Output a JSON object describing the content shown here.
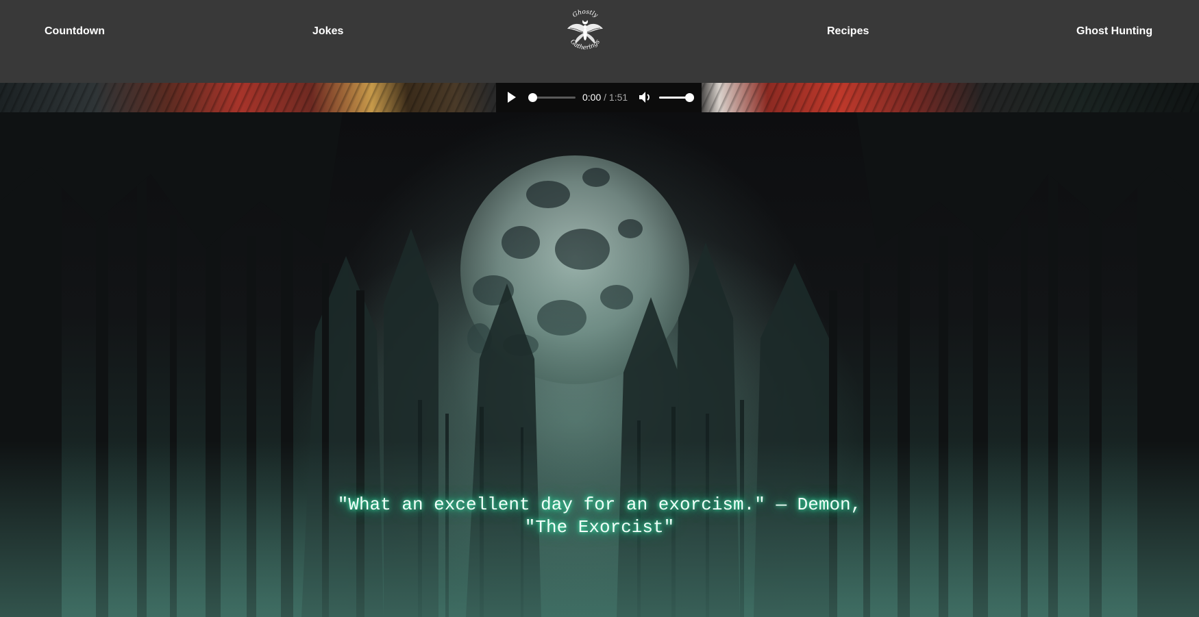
{
  "nav": {
    "links": [
      {
        "label": "Countdown"
      },
      {
        "label": "Jokes"
      },
      {
        "label": "Recipes"
      },
      {
        "label": "Ghost Hunting"
      }
    ],
    "logo": {
      "text_top": "Ghostly",
      "text_bottom": "Gatherings",
      "icon": "moth-icon"
    }
  },
  "audio": {
    "current_time": "0:00",
    "separator": " / ",
    "duration": "1:51",
    "progress": 0,
    "volume": 1,
    "icons": {
      "play": "play-icon",
      "volume": "volume-icon"
    }
  },
  "hero": {
    "quote_line1": "\"What an excellent day for an exorcism.\" — Demon,",
    "quote_line2": "\"The Exorcist\"",
    "glow_color": "#3fe2a8"
  },
  "colors": {
    "nav_bg": "#393939",
    "page_bg": "#0b0c0e",
    "text": "#ffffff"
  }
}
